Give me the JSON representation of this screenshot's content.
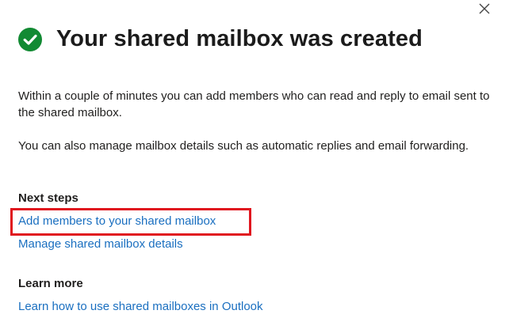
{
  "dialog": {
    "title": "Your shared mailbox was created",
    "paragraph_1": "Within a couple of minutes you can add members who can read and reply to email sent to the shared mailbox.",
    "paragraph_2": "You can also manage mailbox details such as automatic replies and email forwarding.",
    "close_icon": "close-icon",
    "status_icon": "checkmark-circle-icon"
  },
  "next_steps": {
    "heading": "Next steps",
    "links": [
      {
        "label": "Add members to your shared mailbox"
      },
      {
        "label": "Manage shared mailbox details"
      }
    ]
  },
  "learn_more": {
    "heading": "Learn more",
    "link": "Learn how to use shared mailboxes in Outlook"
  },
  "colors": {
    "success_green": "#128a33",
    "link_blue": "#1a6fc0",
    "highlight_red": "#e0161f"
  }
}
